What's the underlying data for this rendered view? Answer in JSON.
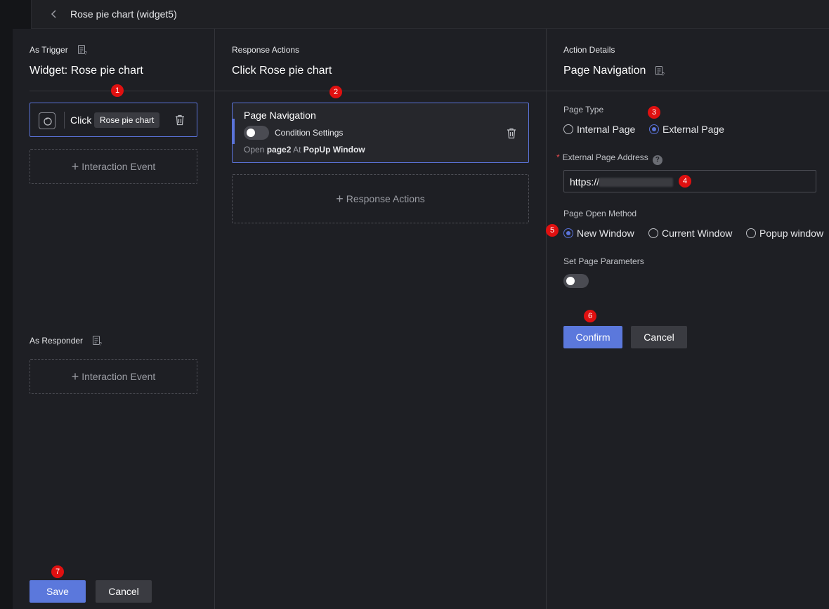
{
  "header": {
    "title": "Rose pie chart (widget5)",
    "back_icon": "chevron-left-icon"
  },
  "trigger_col": {
    "heading": "As Trigger",
    "title": "Widget: Rose pie chart",
    "trigger": {
      "verb": "Click",
      "tag": "Rose pie chart"
    },
    "add_event_label": "Interaction Event",
    "responder_heading": "As Responder",
    "responder_add_label": "Interaction Event"
  },
  "response_col": {
    "heading": "Response Actions",
    "title": "Click Rose pie chart",
    "action": {
      "name": "Page Navigation",
      "condition_label": "Condition Settings",
      "condition_enabled": false,
      "open_prefix": "Open",
      "page": "page2",
      "at": "At",
      "window": "PopUp Window"
    },
    "add_label": "Response Actions"
  },
  "details_col": {
    "heading": "Action Details",
    "title": "Page Navigation",
    "page_type_label": "Page Type",
    "page_type_options": [
      "Internal Page",
      "External Page"
    ],
    "page_type_selected": "External Page",
    "address_label": "External Page Address",
    "address_required_mark": "*",
    "address_help": "?",
    "address_value": "https://",
    "open_method_label": "Page Open Method",
    "open_method_options": [
      "New Window",
      "Current Window",
      "Popup window"
    ],
    "open_method_selected": "New Window",
    "params_label": "Set Page Parameters",
    "params_enabled": false,
    "confirm_label": "Confirm",
    "cancel_label": "Cancel"
  },
  "footer": {
    "save_label": "Save",
    "cancel_label": "Cancel"
  },
  "annotations": [
    "1",
    "2",
    "3",
    "4",
    "5",
    "6",
    "7"
  ],
  "colors": {
    "accent": "#5b78dc",
    "badge": "#e01010",
    "panel": "#1e1f24"
  }
}
